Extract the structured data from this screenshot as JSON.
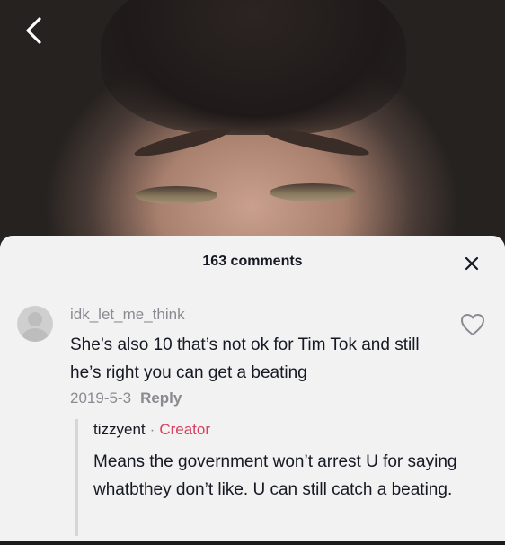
{
  "video": {
    "back_icon": "chevron-left-icon"
  },
  "comments_panel": {
    "count_label": "163 comments",
    "close_icon": "close-icon"
  },
  "comment": {
    "username": "idk_let_me_think",
    "text": "She’s also 10 that’s not ok for Tim Tok and still he’s right you can get a beating",
    "date": "2019-5-3",
    "reply_label": "Reply",
    "like_icon": "heart-outline-icon"
  },
  "reply": {
    "username": "tizzyent",
    "separator": "·",
    "badge": "Creator",
    "badge_color": "#d7405e",
    "text": "Means the government won’t arrest U for saying whatbthey don’t like. U can still catch a beating."
  }
}
